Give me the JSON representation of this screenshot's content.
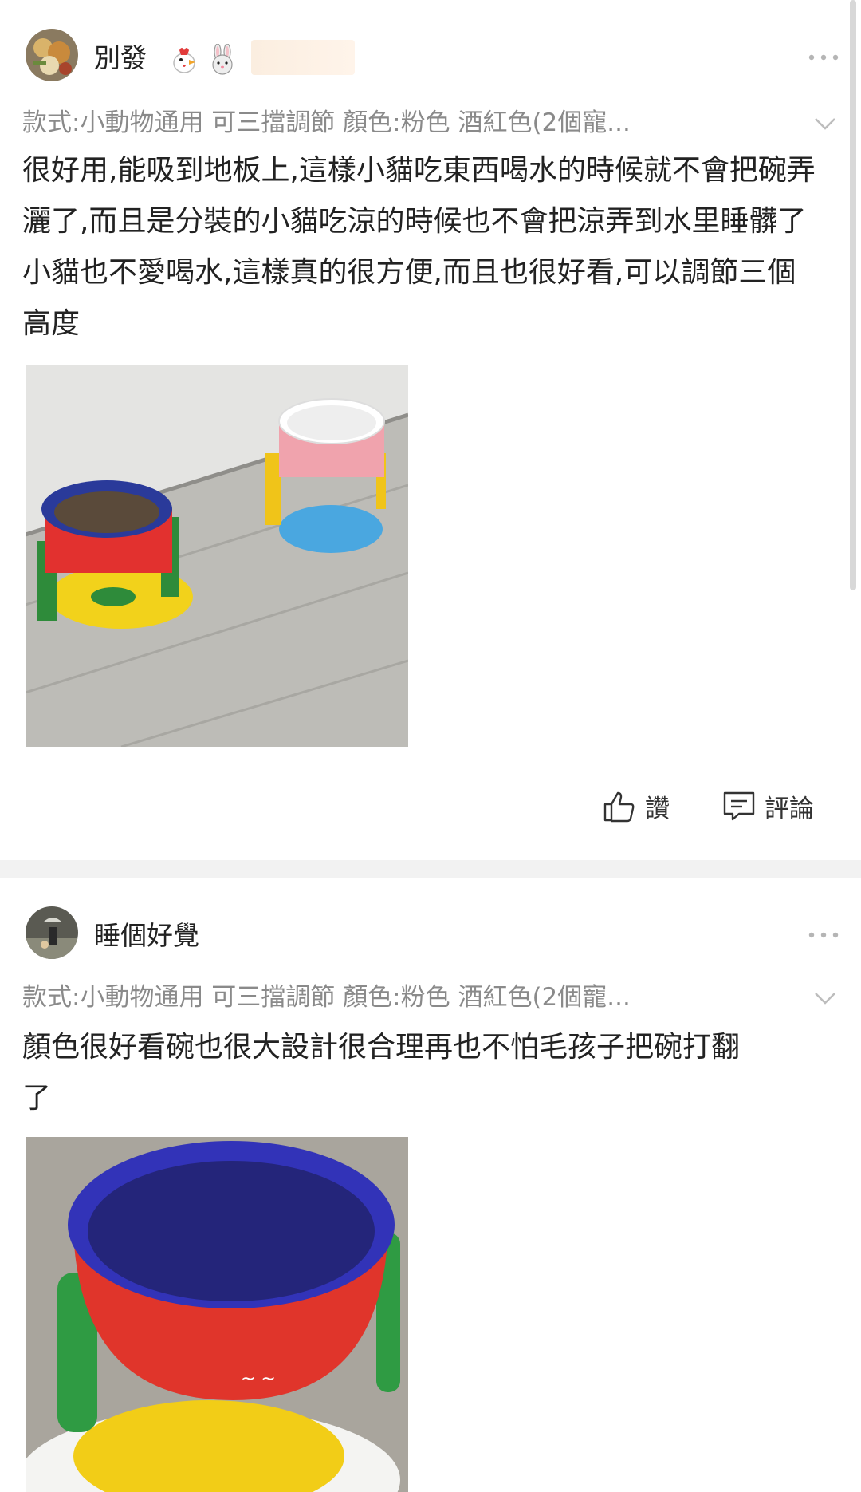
{
  "reviews": [
    {
      "username": "別發",
      "variant": "款式:小動物通用 可三擋調節 顏色:粉色 酒紅色(2個寵...",
      "text": "很好用,能吸到地板上,這樣小貓吃東西喝水的時候就不會把碗弄灑了,而且是分裝的小貓吃涼的時候也不會把涼弄到水里睡髒了小貓也不愛喝水,這樣真的很方便,而且也很好看,可以調節三個高度",
      "icons": [
        "chicken-emoji-icon",
        "rabbit-emoji-icon"
      ]
    },
    {
      "username": "睡個好覺",
      "variant": "款式:小動物通用 可三擋調節 顏色:粉色 酒紅色(2個寵...",
      "text": "顏色很好看碗也很大設計很合理再也不怕毛孩子把碗打翻了"
    }
  ],
  "actions": {
    "like_label": "讚",
    "comment_label": "評論"
  },
  "colors": {
    "secondary_text": "#8a8a8a",
    "divider": "#f2f2f2"
  }
}
